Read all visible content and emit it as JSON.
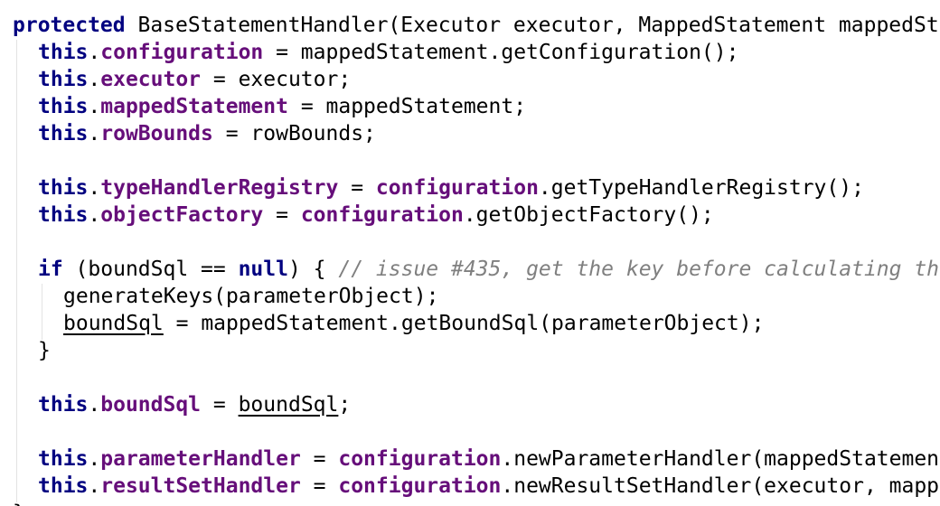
{
  "editor": {
    "language": "Java",
    "colors": {
      "keyword": "#000080",
      "field": "#660e7a",
      "comment": "#808080",
      "plain": "#000000",
      "indent_guide": "#e3e3e3",
      "background": "#ffffff"
    },
    "lines": [
      {
        "indent": 0,
        "tokens": [
          {
            "t": "kw",
            "v": "protected"
          },
          {
            "t": "p",
            "v": " BaseStatementHandler(Executor executor, MappedStatement mappedSt"
          }
        ]
      },
      {
        "indent": 1,
        "tokens": [
          {
            "t": "kw",
            "v": "this"
          },
          {
            "t": "p",
            "v": "."
          },
          {
            "t": "field",
            "v": "configuration"
          },
          {
            "t": "p",
            "v": " = mappedStatement.getConfiguration();"
          }
        ]
      },
      {
        "indent": 1,
        "tokens": [
          {
            "t": "kw",
            "v": "this"
          },
          {
            "t": "p",
            "v": "."
          },
          {
            "t": "field",
            "v": "executor"
          },
          {
            "t": "p",
            "v": " = executor;"
          }
        ]
      },
      {
        "indent": 1,
        "tokens": [
          {
            "t": "kw",
            "v": "this"
          },
          {
            "t": "p",
            "v": "."
          },
          {
            "t": "field",
            "v": "mappedStatement"
          },
          {
            "t": "p",
            "v": " = mappedStatement;"
          }
        ]
      },
      {
        "indent": 1,
        "tokens": [
          {
            "t": "kw",
            "v": "this"
          },
          {
            "t": "p",
            "v": "."
          },
          {
            "t": "field",
            "v": "rowBounds"
          },
          {
            "t": "p",
            "v": " = rowBounds;"
          }
        ]
      },
      {
        "indent": 0,
        "tokens": []
      },
      {
        "indent": 1,
        "tokens": [
          {
            "t": "kw",
            "v": "this"
          },
          {
            "t": "p",
            "v": "."
          },
          {
            "t": "field",
            "v": "typeHandlerRegistry"
          },
          {
            "t": "p",
            "v": " = "
          },
          {
            "t": "field",
            "v": "configuration"
          },
          {
            "t": "p",
            "v": ".getTypeHandlerRegistry();"
          }
        ]
      },
      {
        "indent": 1,
        "tokens": [
          {
            "t": "kw",
            "v": "this"
          },
          {
            "t": "p",
            "v": "."
          },
          {
            "t": "field",
            "v": "objectFactory"
          },
          {
            "t": "p",
            "v": " = "
          },
          {
            "t": "field",
            "v": "configuration"
          },
          {
            "t": "p",
            "v": ".getObjectFactory();"
          }
        ]
      },
      {
        "indent": 0,
        "tokens": []
      },
      {
        "indent": 1,
        "tokens": [
          {
            "t": "kw",
            "v": "if"
          },
          {
            "t": "p",
            "v": " (boundSql == "
          },
          {
            "t": "kw",
            "v": "null"
          },
          {
            "t": "p",
            "v": ") { "
          },
          {
            "t": "comment",
            "v": "// issue #435, get the key before calculating th"
          }
        ]
      },
      {
        "indent": 2,
        "tokens": [
          {
            "t": "p",
            "v": "generateKeys(parameterObject);"
          }
        ]
      },
      {
        "indent": 2,
        "tokens": [
          {
            "t": "u",
            "v": "boundSql"
          },
          {
            "t": "p",
            "v": " = mappedStatement.getBoundSql(parameterObject);"
          }
        ]
      },
      {
        "indent": 1,
        "tokens": [
          {
            "t": "p",
            "v": "}"
          }
        ]
      },
      {
        "indent": 0,
        "tokens": []
      },
      {
        "indent": 1,
        "tokens": [
          {
            "t": "kw",
            "v": "this"
          },
          {
            "t": "p",
            "v": "."
          },
          {
            "t": "field",
            "v": "boundSql"
          },
          {
            "t": "p",
            "v": " = "
          },
          {
            "t": "u",
            "v": "boundSql"
          },
          {
            "t": "p",
            "v": ";"
          }
        ]
      },
      {
        "indent": 0,
        "tokens": []
      },
      {
        "indent": 1,
        "tokens": [
          {
            "t": "kw",
            "v": "this"
          },
          {
            "t": "p",
            "v": "."
          },
          {
            "t": "field",
            "v": "parameterHandler"
          },
          {
            "t": "p",
            "v": " = "
          },
          {
            "t": "field",
            "v": "configuration"
          },
          {
            "t": "p",
            "v": ".newParameterHandler(mappedStatemen"
          }
        ]
      },
      {
        "indent": 1,
        "tokens": [
          {
            "t": "kw",
            "v": "this"
          },
          {
            "t": "p",
            "v": "."
          },
          {
            "t": "field",
            "v": "resultSetHandler"
          },
          {
            "t": "p",
            "v": " = "
          },
          {
            "t": "field",
            "v": "configuration"
          },
          {
            "t": "p",
            "v": ".newResultSetHandler(executor, mapp"
          }
        ]
      },
      {
        "indent": 0,
        "tokens": [
          {
            "t": "p",
            "v": "}"
          }
        ]
      }
    ]
  }
}
